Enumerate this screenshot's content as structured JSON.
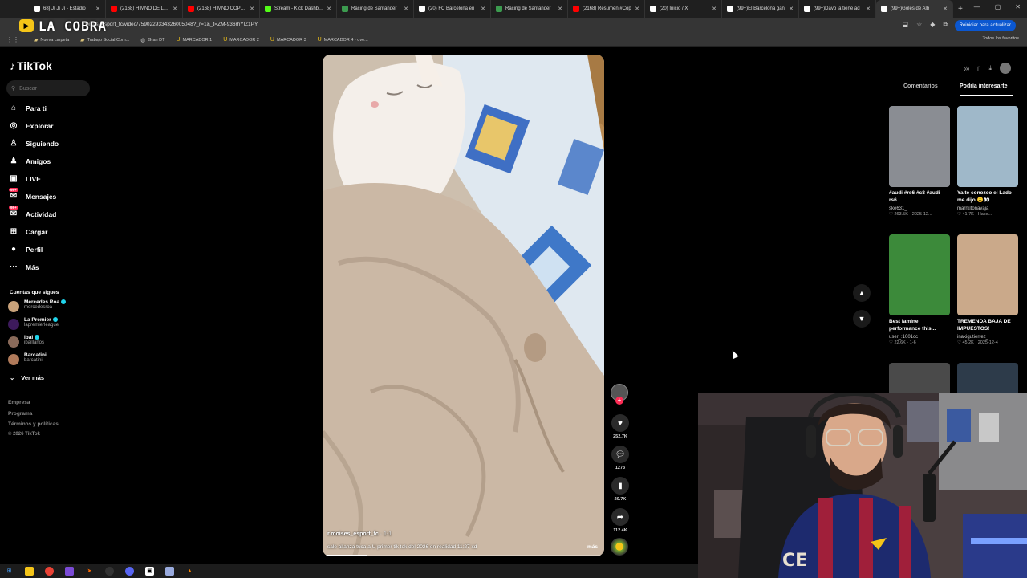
{
  "browser": {
    "tabs": [
      {
        "label": "68] Jí Jí Jí - Estadio",
        "color": "#ffffff"
      },
      {
        "label": "(2168) HIMNO DE LA C",
        "color": "#ff0000"
      },
      {
        "label": "(2168) HIMNO COPA L",
        "color": "#ff0000"
      },
      {
        "label": "Stream - Kick Dashboar",
        "color": "#53fc18"
      },
      {
        "label": "Racing de Santander",
        "color": "#3c9b4f"
      },
      {
        "label": "(20) FC Barcelona en",
        "color": "#ffffff"
      },
      {
        "label": "Racing de Santander",
        "color": "#3c9b4f"
      },
      {
        "label": "(2168) Resumen #Cop",
        "color": "#ff0000"
      },
      {
        "label": "(20) Inicio / X",
        "color": "#ffffff"
      },
      {
        "label": "(99+)El Barcelona gan",
        "color": "#ffffff"
      },
      {
        "label": "(99+)Davo la tiene ad",
        "color": "#ffffff"
      },
      {
        "label": "(99+)Goles de Alb",
        "color": "#ffffff",
        "active": true
      }
    ],
    "new_tab": "+",
    "window_controls": [
      "—",
      "▢",
      "✕"
    ],
    "url": "moises_esport_fc/video/7590229334326005048?_r=1&_t=ZM-936rhYlZ1PY",
    "update_button": "Reiniciar para actualizar",
    "bookmarks": [
      {
        "label": "Nueva carpeta",
        "icon": "folder-icon"
      },
      {
        "label": "Trabajo Social Com...",
        "icon": "folder-icon"
      },
      {
        "label": "Gran DT",
        "icon": "globe-icon"
      },
      {
        "label": "MARCADOR 1",
        "icon": "u-icon"
      },
      {
        "label": "MARCADOR 2",
        "icon": "u-icon"
      },
      {
        "label": "MARCADOR 3",
        "icon": "u-icon"
      },
      {
        "label": "MARCADOR 4 - ove...",
        "icon": "u-icon"
      }
    ],
    "all_bookmarks": "Todos los favoritos"
  },
  "overlay": {
    "brand": "LA COBRA"
  },
  "tiktok": {
    "logo": "TikTok",
    "search_placeholder": "Buscar",
    "nav": [
      {
        "label": "Para ti",
        "icon": "⌂"
      },
      {
        "label": "Explorar",
        "icon": "◎"
      },
      {
        "label": "Siguiendo",
        "icon": "♙"
      },
      {
        "label": "Amigos",
        "icon": "♟"
      },
      {
        "label": "LIVE",
        "icon": "▣"
      },
      {
        "label": "Mensajes",
        "icon": "✉",
        "badge": "99+"
      },
      {
        "label": "Actividad",
        "icon": "✉",
        "badge": "99+"
      },
      {
        "label": "Cargar",
        "icon": "⊞"
      },
      {
        "label": "Perfil",
        "icon": "●"
      },
      {
        "label": "Más",
        "icon": "···"
      }
    ],
    "following_header": "Cuentas que sigues",
    "following": [
      {
        "name": "Mercedes Roa",
        "handle": "mercedesroa",
        "verified": true
      },
      {
        "name": "La Premier",
        "handle": "lapremierleague",
        "verified": true
      },
      {
        "name": "Ibai",
        "handle": "ibaillanos",
        "verified": true
      },
      {
        "name": "Barcatini",
        "handle": "barcatini",
        "verified": false
      }
    ],
    "see_more": "Ver más",
    "footer": [
      "Empresa",
      "Programa",
      "Términos y políticas",
      "© 2026 TikTok"
    ],
    "video": {
      "author": "r.moises_esport_fc",
      "date": " · 1-1",
      "caption": "sale alianza tuca a U primer tik tok del 2026 en realidad 11:27 xd",
      "more": "más",
      "progress": 0.16
    },
    "actions": {
      "likes": "252.7K",
      "comments": "1273",
      "saves": "20.7K",
      "shares": "112.4K"
    },
    "right_panel": {
      "tabs": [
        "Comentarios",
        "Podría interesarte"
      ],
      "active_tab": 1,
      "cards": [
        {
          "title": "#audi #rs6 #c8 #audi rs6...",
          "author": "ske631_",
          "likes": "263.5K",
          "date": "2025-12...",
          "thumb": "#8a8d93"
        },
        {
          "title": "Ya te conozco el Lado me dijo 🙃👀",
          "author": "marrkitonavaja",
          "likes": "41.7K",
          "date": "Hace...",
          "thumb": "#9fb8c9"
        },
        {
          "title": "Best lamine performance this...",
          "author": "user_:1001cc",
          "likes": "22.6K",
          "date": "1-6",
          "thumb": "#3c8a3a"
        },
        {
          "title": "TREMENDA BAJA DE IMPUESTOS!",
          "author": "inakigutierrez_",
          "likes": "45.2K",
          "date": "2025-12-4",
          "thumb": "#caa98a"
        },
        {
          "title": "",
          "author": "",
          "likes": "",
          "date": "",
          "thumb": "#4a4a4a"
        },
        {
          "title": "",
          "author": "",
          "likes": "",
          "date": "",
          "thumb": "#2d3b4a"
        }
      ]
    }
  }
}
